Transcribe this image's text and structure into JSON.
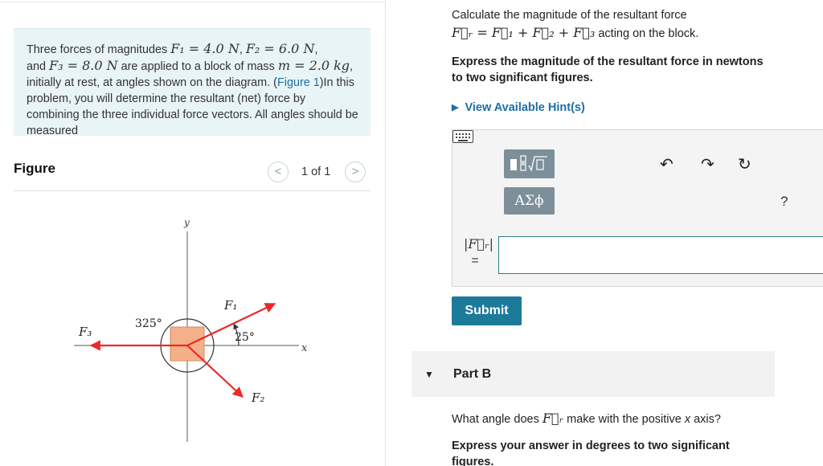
{
  "problem": {
    "text_1": "Three forces of magnitudes ",
    "f1": "F₁ = 4.0 N",
    "sep1": ", ",
    "f2": "F₂ = 6.0 N",
    "sep2": ",",
    "text_2": " and ",
    "f3": "F₃ = 8.0 N",
    "text_3": " are applied to a block of mass ",
    "mass": "m = 2.0 kg",
    "text_4": ", initially at rest, at angles shown on the diagram. (",
    "figure_link": "Figure 1",
    "text_5": ")In this problem, you will determine the resultant (net) force by combining the three individual force vectors. All angles should be measured"
  },
  "figure": {
    "title": "Figure",
    "page_indicator": "1 of 1",
    "prev_label": "<",
    "next_label": ">",
    "labels": {
      "y_axis": "y",
      "x_axis": "x",
      "f1": "F₁",
      "f2": "F₂",
      "f3": "F₃",
      "angle_325": "325°",
      "angle_25": "25°"
    }
  },
  "part_a": {
    "question_1": "Calculate the magnitude of the resultant force",
    "equation": "F⃗ᵣ = F⃗₁ + F⃗₂ + F⃗₃",
    "question_2": " acting on the block.",
    "instruction": "Express the magnitude of the resultant force in newtons to two significant figures.",
    "hints_label": "View Available Hint(s)",
    "answer_label": "|F⃗ᵣ|",
    "answer_equals": "=",
    "answer_value": "",
    "symbols_label": "ΑΣϕ",
    "help_label": "?",
    "submit_label": "Submit"
  },
  "part_b": {
    "title": "Part B",
    "question_1": "What angle does ",
    "symbol": "F⃗ᵣ",
    "question_2": " make with the positive ",
    "axis": "x",
    "question_3": " axis?",
    "instruction": "Express your answer in degrees to two significant figures."
  },
  "colors": {
    "force_arrow": "#ea2a2a",
    "block": "#f4b089",
    "link": "#1d6fa5",
    "submit": "#1c7a9a",
    "problem_bg": "#e8f4f6",
    "tool_button": "#7d8f99"
  }
}
